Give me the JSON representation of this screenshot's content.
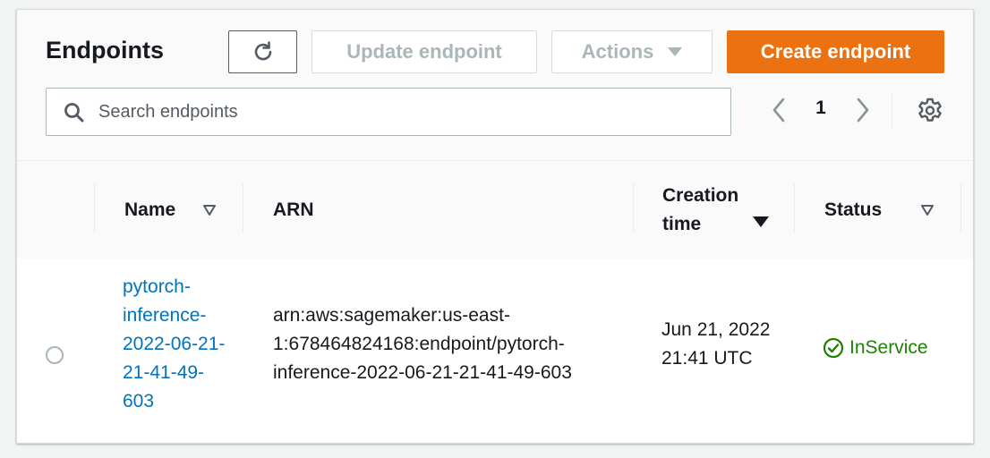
{
  "header": {
    "title": "Endpoints",
    "refresh_icon": "refresh-icon",
    "update_label": "Update endpoint",
    "actions_label": "Actions",
    "create_label": "Create endpoint",
    "accent_color": "#ec7211"
  },
  "search": {
    "placeholder": "Search endpoints",
    "value": ""
  },
  "pagination": {
    "current_page": "1"
  },
  "table": {
    "columns": [
      {
        "label": "Name"
      },
      {
        "label": "ARN"
      },
      {
        "label": "Creation time"
      },
      {
        "label": "Status"
      }
    ],
    "rows": [
      {
        "name": "pytorch-inference-2022-06-21-21-41-49-603",
        "arn": "arn:aws:sagemaker:us-east-1:678464824168:endpoint/pytorch-inference-2022-06-21-21-41-49-603",
        "creation_time": "Jun 21, 2022 21:41 UTC",
        "status": "InService",
        "status_color": "#1d8102"
      }
    ]
  }
}
